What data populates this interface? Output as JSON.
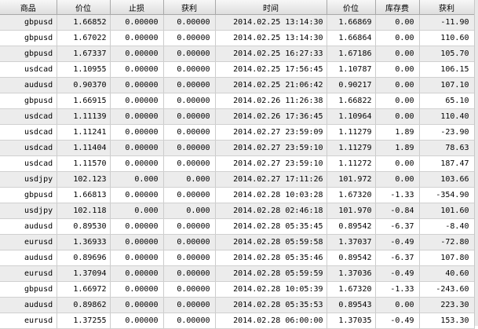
{
  "columns": [
    "商品",
    "价位",
    "止损",
    "获利",
    "时间",
    "价位",
    "库存费",
    "获利"
  ],
  "rows": [
    [
      "gbpusd",
      "1.66852",
      "0.00000",
      "0.00000",
      "2014.02.25 13:14:30",
      "1.66869",
      "0.00",
      "-11.90"
    ],
    [
      "gbpusd",
      "1.67022",
      "0.00000",
      "0.00000",
      "2014.02.25 13:14:30",
      "1.66864",
      "0.00",
      "110.60"
    ],
    [
      "gbpusd",
      "1.67337",
      "0.00000",
      "0.00000",
      "2014.02.25 16:27:33",
      "1.67186",
      "0.00",
      "105.70"
    ],
    [
      "usdcad",
      "1.10955",
      "0.00000",
      "0.00000",
      "2014.02.25 17:56:45",
      "1.10787",
      "0.00",
      "106.15"
    ],
    [
      "audusd",
      "0.90370",
      "0.00000",
      "0.00000",
      "2014.02.25 21:06:42",
      "0.90217",
      "0.00",
      "107.10"
    ],
    [
      "gbpusd",
      "1.66915",
      "0.00000",
      "0.00000",
      "2014.02.26 11:26:38",
      "1.66822",
      "0.00",
      "65.10"
    ],
    [
      "usdcad",
      "1.11139",
      "0.00000",
      "0.00000",
      "2014.02.26 17:36:45",
      "1.10964",
      "0.00",
      "110.40"
    ],
    [
      "usdcad",
      "1.11241",
      "0.00000",
      "0.00000",
      "2014.02.27 23:59:09",
      "1.11279",
      "1.89",
      "-23.90"
    ],
    [
      "usdcad",
      "1.11404",
      "0.00000",
      "0.00000",
      "2014.02.27 23:59:10",
      "1.11279",
      "1.89",
      "78.63"
    ],
    [
      "usdcad",
      "1.11570",
      "0.00000",
      "0.00000",
      "2014.02.27 23:59:10",
      "1.11272",
      "0.00",
      "187.47"
    ],
    [
      "usdjpy",
      "102.123",
      "0.000",
      "0.000",
      "2014.02.27 17:11:26",
      "101.972",
      "0.00",
      "103.66"
    ],
    [
      "gbpusd",
      "1.66813",
      "0.00000",
      "0.00000",
      "2014.02.28 10:03:28",
      "1.67320",
      "-1.33",
      "-354.90"
    ],
    [
      "usdjpy",
      "102.118",
      "0.000",
      "0.000",
      "2014.02.28 02:46:18",
      "101.970",
      "-0.84",
      "101.60"
    ],
    [
      "audusd",
      "0.89530",
      "0.00000",
      "0.00000",
      "2014.02.28 05:35:45",
      "0.89542",
      "-6.37",
      "-8.40"
    ],
    [
      "eurusd",
      "1.36933",
      "0.00000",
      "0.00000",
      "2014.02.28 05:59:58",
      "1.37037",
      "-0.49",
      "-72.80"
    ],
    [
      "audusd",
      "0.89696",
      "0.00000",
      "0.00000",
      "2014.02.28 05:35:46",
      "0.89542",
      "-6.37",
      "107.80"
    ],
    [
      "eurusd",
      "1.37094",
      "0.00000",
      "0.00000",
      "2014.02.28 05:59:59",
      "1.37036",
      "-0.49",
      "40.60"
    ],
    [
      "gbpusd",
      "1.66972",
      "0.00000",
      "0.00000",
      "2014.02.28 10:05:39",
      "1.67320",
      "-1.33",
      "-243.60"
    ],
    [
      "audusd",
      "0.89862",
      "0.00000",
      "0.00000",
      "2014.02.28 05:35:53",
      "0.89543",
      "0.00",
      "223.30"
    ],
    [
      "eurusd",
      "1.37255",
      "0.00000",
      "0.00000",
      "2014.02.28 06:00:00",
      "1.37035",
      "-0.49",
      "153.30"
    ]
  ]
}
